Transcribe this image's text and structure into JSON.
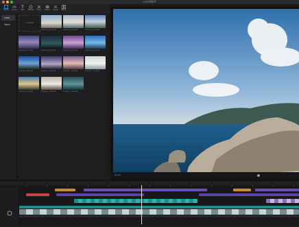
{
  "window": {
    "title": "vivaSWAT"
  },
  "toolbar": {
    "tools": [
      {
        "icon": "media-icon",
        "label": "Media",
        "active": true
      },
      {
        "icon": "audio-icon",
        "label": "Audio"
      },
      {
        "icon": "text-icon",
        "label": "Text"
      },
      {
        "icon": "effects-icon",
        "label": "Effects"
      },
      {
        "icon": "transitions-icon",
        "label": "Trans"
      },
      {
        "icon": "filters-icon",
        "label": "Filters"
      },
      {
        "icon": "adjust-icon",
        "label": "Adjust"
      },
      {
        "icon": "templates-icon",
        "label": "Temp"
      }
    ]
  },
  "sidebar": {
    "items": [
      {
        "label": "Local",
        "active": true
      },
      {
        "label": "Stock"
      }
    ]
  },
  "browser": {
    "import_label": "+ Import",
    "thumbs": [
      {
        "caption": "scenery_01.mp4"
      },
      {
        "caption": "scenery_02.mp4"
      },
      {
        "caption": "scenery_03.mp4"
      },
      {
        "caption": "scenery_04.mp4"
      },
      {
        "caption": "scenery_05.mp4"
      },
      {
        "caption": "scenery_06.mp4"
      },
      {
        "caption": "scenery_07.mp4"
      },
      {
        "caption": "scenery_08.mp4"
      },
      {
        "caption": "scenery_09.mp4"
      },
      {
        "caption": "scenery_10.mp4"
      },
      {
        "caption": "scenery_11.mp4"
      },
      {
        "caption": "scenery_12.mp4"
      },
      {
        "caption": "scenery_13.mp4"
      },
      {
        "caption": "scenery_14.mp4"
      }
    ]
  },
  "viewer": {
    "timecode": "00:00",
    "center_mark": "■"
  },
  "colors": {
    "accent": "#3ea6ff",
    "purple": "#6a4fb3",
    "orange": "#c98a2b",
    "red": "#c0473a",
    "teal": "#1d8f8a"
  }
}
